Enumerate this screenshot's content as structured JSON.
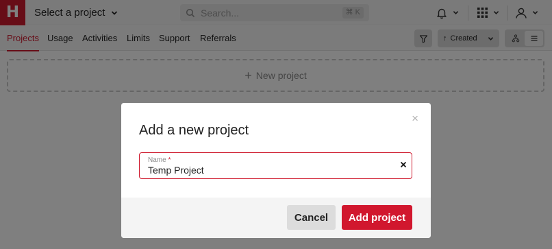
{
  "app": {
    "logo_letter": "H"
  },
  "header": {
    "project_select_label": "Select a project",
    "search_placeholder": "Search...",
    "search_shortcut": "⌘ K"
  },
  "nav": {
    "tabs": [
      {
        "label": "Projects",
        "active": true
      },
      {
        "label": "Usage",
        "active": false
      },
      {
        "label": "Activities",
        "active": false
      },
      {
        "label": "Limits",
        "active": false
      },
      {
        "label": "Support",
        "active": false
      },
      {
        "label": "Referrals",
        "active": false
      }
    ],
    "sort_label": "Created",
    "sort_arrow": "↑"
  },
  "main": {
    "new_project_label": "New project",
    "new_project_plus": "+"
  },
  "modal": {
    "title": "Add a new project",
    "close_glyph": "×",
    "field_label": "Name",
    "field_required_mark": "*",
    "field_value": "Temp Project",
    "cancel_label": "Cancel",
    "submit_label": "Add project"
  },
  "colors": {
    "brand": "#cf1a2e",
    "overlay": "rgba(0,0,0,0.5)"
  },
  "icons": [
    "logo-icon",
    "chevron-down-icon",
    "search-icon",
    "bell-icon",
    "apps-grid-icon",
    "user-icon",
    "filter-icon",
    "hierarchy-icon",
    "list-icon",
    "plus-icon",
    "close-icon",
    "clear-icon"
  ]
}
